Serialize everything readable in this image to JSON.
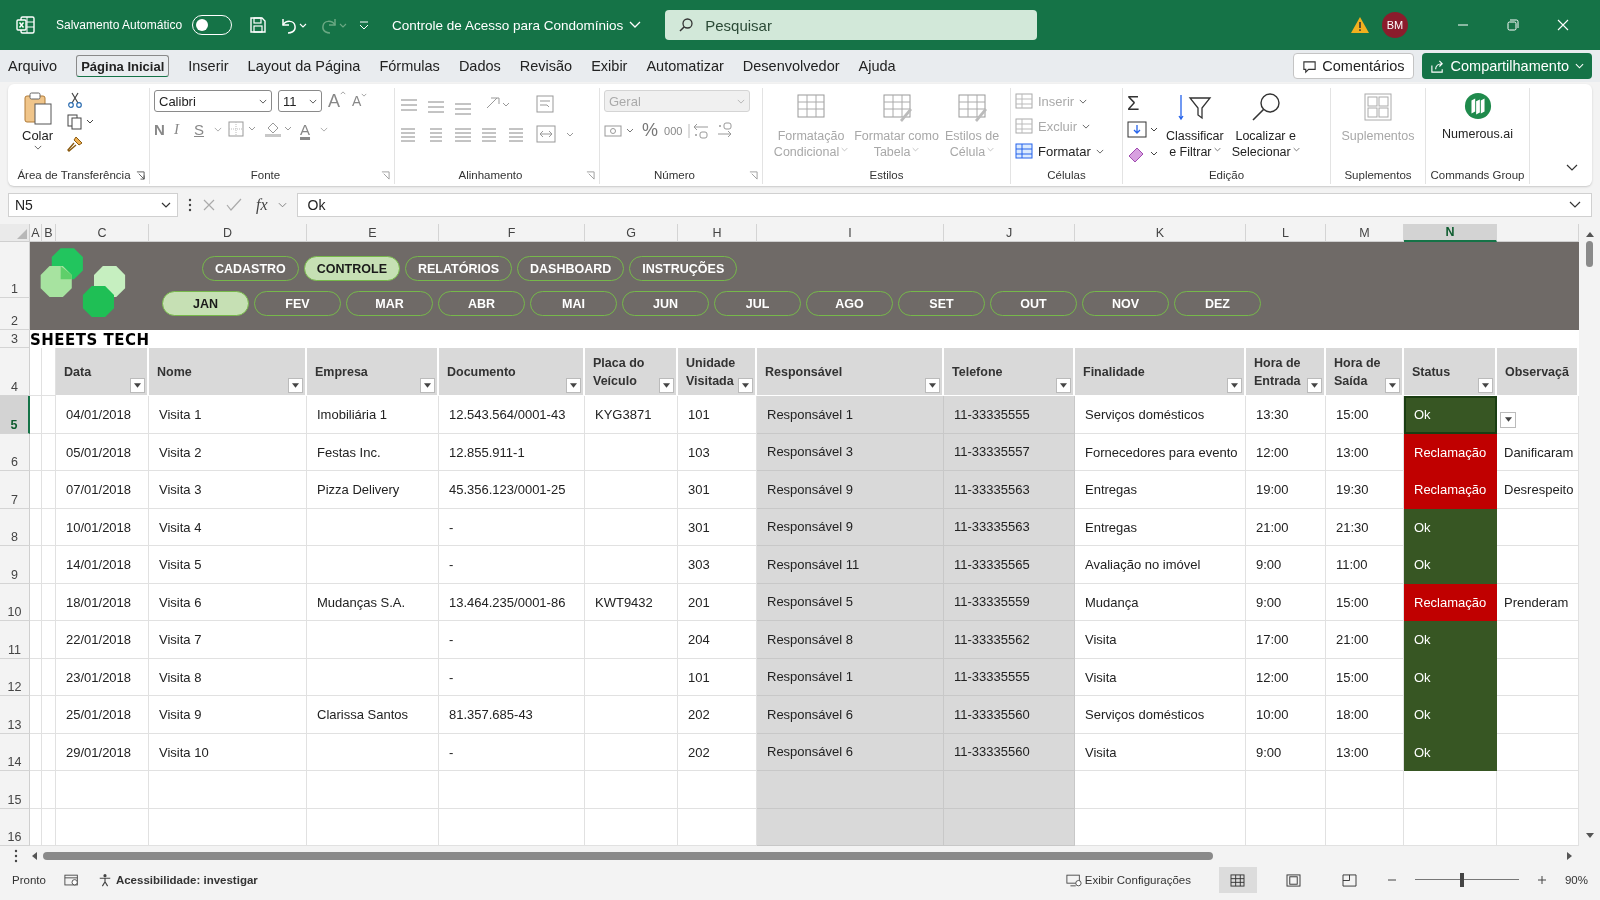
{
  "title_bar": {
    "autosave_label": "Salvamento Automático",
    "autosave_on": false,
    "document_title": "Controle de Acesso para Condomínios",
    "search_placeholder": "Pesquisar",
    "avatar_initials": "BM"
  },
  "menu_tabs": [
    {
      "label": "Arquivo",
      "selected": false
    },
    {
      "label": "Página Inicial",
      "selected": true
    },
    {
      "label": "Inserir",
      "selected": false
    },
    {
      "label": "Layout da Página",
      "selected": false
    },
    {
      "label": "Fórmulas",
      "selected": false
    },
    {
      "label": "Dados",
      "selected": false
    },
    {
      "label": "Revisão",
      "selected": false
    },
    {
      "label": "Exibir",
      "selected": false
    },
    {
      "label": "Automatizar",
      "selected": false
    },
    {
      "label": "Desenvolvedor",
      "selected": false
    },
    {
      "label": "Ajuda",
      "selected": false
    }
  ],
  "comments_button": "Comentários",
  "share_button": "Compartilhamento",
  "ribbon": {
    "clipboard": {
      "paste": "Colar",
      "caption": "Área de Transferência"
    },
    "font": {
      "family": "Calibri",
      "size": "11",
      "grow": "A",
      "shrink": "A",
      "bold": "N",
      "italic": "I",
      "underline": "S",
      "font_color": "A",
      "caption": "Fonte"
    },
    "alignment": {
      "caption": "Alinhamento"
    },
    "number": {
      "format": "Geral",
      "format_disabled": true,
      "percent": "%",
      "thousands": "000",
      "caption": "Número"
    },
    "styles": {
      "items": [
        {
          "lines": [
            "Formatação",
            "Condicional"
          ],
          "disabled": true
        },
        {
          "lines": [
            "Formatar como",
            "Tabela"
          ],
          "disabled": true
        },
        {
          "lines": [
            "Estilos de",
            "Célula"
          ],
          "disabled": true
        }
      ],
      "caption": "Estilos"
    },
    "cells": {
      "items": [
        {
          "label": "Inserir",
          "disabled": true
        },
        {
          "label": "Excluir",
          "disabled": true
        },
        {
          "label": "Formatar",
          "disabled": false
        }
      ],
      "caption": "Células"
    },
    "editing": {
      "autosum": "Σ",
      "items": [
        {
          "lines": [
            "Classificar",
            "e Filtrar"
          ]
        },
        {
          "lines": [
            "Localizar e",
            "Selecionar"
          ]
        }
      ],
      "caption": "Edição"
    },
    "addins": {
      "label": "Suplementos",
      "disabled": true,
      "caption": "Suplementos"
    },
    "commands": {
      "label": "Numerous.ai",
      "caption": "Commands Group"
    }
  },
  "formula_bar": {
    "name_box": "N5",
    "function_label": "fx",
    "value": "Ok"
  },
  "sheet": {
    "column_letters": [
      "A",
      "B",
      "C",
      "D",
      "E",
      "F",
      "G",
      "H",
      "I",
      "J",
      "K",
      "L",
      "M",
      "N"
    ],
    "row_numbers": [
      "1",
      "2",
      "3",
      "4",
      "5",
      "6",
      "7",
      "8",
      "9",
      "10",
      "11",
      "12",
      "13",
      "14",
      "15",
      "16"
    ],
    "nav_tabs": [
      {
        "label": "CADASTRO",
        "selected": false
      },
      {
        "label": "CONTROLE",
        "selected": true
      },
      {
        "label": "RELATÓRIOS",
        "selected": false
      },
      {
        "label": "DASHBOARD",
        "selected": false
      },
      {
        "label": "INSTRUÇÕES",
        "selected": false
      }
    ],
    "months": [
      {
        "label": "JAN",
        "selected": true
      },
      {
        "label": "FEV",
        "selected": false
      },
      {
        "label": "MAR",
        "selected": false
      },
      {
        "label": "ABR",
        "selected": false
      },
      {
        "label": "MAI",
        "selected": false
      },
      {
        "label": "JUN",
        "selected": false
      },
      {
        "label": "JUL",
        "selected": false
      },
      {
        "label": "AGO",
        "selected": false
      },
      {
        "label": "SET",
        "selected": false
      },
      {
        "label": "OUT",
        "selected": false
      },
      {
        "label": "NOV",
        "selected": false
      },
      {
        "label": "DEZ",
        "selected": false
      }
    ],
    "brand": "SHEETS TECH",
    "columns": [
      "Data",
      "Nome",
      "Empresa",
      "Documento",
      "Placa do Veículo",
      "Unidade Visitada",
      "Responsável",
      "Telefone",
      "Finalidade",
      "Hora de Entrada",
      "Hora de Saída",
      "Status",
      "Observaçã"
    ],
    "rows": [
      {
        "date": "04/01/2018",
        "name": "Visita 1",
        "company": "Imobiliária 1",
        "document": "12.543.564/0001-43",
        "plate": "KYG3871",
        "unit": "101",
        "responsible": "Responsável 1",
        "phone": "11-33335555",
        "purpose": "Serviços domésticos",
        "entry": "13:30",
        "exit": "15:00",
        "status": {
          "label": "Ok",
          "kind": "ok",
          "selected": true
        }
      },
      {
        "date": "05/01/2018",
        "name": "Visita 2",
        "company": "Festas Inc.",
        "document": "12.855.911-1",
        "unit": "103",
        "responsible": "Responsável 3",
        "phone": "11-33335557",
        "purpose": "Fornecedores para evento",
        "entry": "12:00",
        "exit": "13:00",
        "status": {
          "label": "Reclamação",
          "kind": "complaint",
          "selected": false
        },
        "note": "Danificaram"
      },
      {
        "date": "07/01/2018",
        "name": "Visita 3",
        "company": "Pizza Delivery",
        "document": "45.356.123/0001-25",
        "unit": "301",
        "responsible": "Responsável 9",
        "phone": "11-33335563",
        "purpose": "Entregas",
        "entry": "19:00",
        "exit": "19:30",
        "status": {
          "label": "Reclamação",
          "kind": "complaint",
          "selected": false
        },
        "note": "Desrespeito"
      },
      {
        "date": "10/01/2018",
        "name": "Visita 4",
        "document": "-",
        "unit": "301",
        "responsible": "Responsável 9",
        "phone": "11-33335563",
        "purpose": "Entregas",
        "entry": "21:00",
        "exit": "21:30",
        "status": {
          "label": "Ok",
          "kind": "ok",
          "selected": false
        }
      },
      {
        "date": "14/01/2018",
        "name": "Visita 5",
        "document": "-",
        "unit": "303",
        "responsible": "Responsável 11",
        "phone": "11-33335565",
        "purpose": "Avaliação no imóvel",
        "entry": "9:00",
        "exit": "11:00",
        "status": {
          "label": "Ok",
          "kind": "ok",
          "selected": false
        }
      },
      {
        "date": "18/01/2018",
        "name": "Visita 6",
        "company": "Mudanças S.A.",
        "document": "13.464.235/0001-86",
        "plate": "KWT9432",
        "unit": "201",
        "responsible": "Responsável 5",
        "phone": "11-33335559",
        "purpose": "Mudança",
        "entry": "9:00",
        "exit": "15:00",
        "status": {
          "label": "Reclamação",
          "kind": "complaint",
          "selected": false
        },
        "note": "Prenderam"
      },
      {
        "date": "22/01/2018",
        "name": "Visita 7",
        "document": "-",
        "unit": "204",
        "responsible": "Responsável 8",
        "phone": "11-33335562",
        "purpose": "Visita",
        "entry": "17:00",
        "exit": "21:00",
        "status": {
          "label": "Ok",
          "kind": "ok",
          "selected": false
        }
      },
      {
        "date": "23/01/2018",
        "name": "Visita 8",
        "document": "-",
        "unit": "101",
        "responsible": "Responsável 1",
        "phone": "11-33335555",
        "purpose": "Visita",
        "entry": "12:00",
        "exit": "15:00",
        "status": {
          "label": "Ok",
          "kind": "ok",
          "selected": false
        }
      },
      {
        "date": "25/01/2018",
        "name": "Visita 9",
        "company": "Clarissa Santos",
        "document": "81.357.685-43",
        "unit": "202",
        "responsible": "Responsável 6",
        "phone": "11-33335560",
        "purpose": "Serviços domésticos",
        "entry": "10:00",
        "exit": "18:00",
        "status": {
          "label": "Ok",
          "kind": "ok",
          "selected": false
        }
      },
      {
        "date": "29/01/2018",
        "name": "Visita 10",
        "document": "-",
        "unit": "202",
        "responsible": "Responsável 6",
        "phone": "11-33335560",
        "purpose": "Visita",
        "entry": "9:00",
        "exit": "13:00",
        "status": {
          "label": "Ok",
          "kind": "ok",
          "selected": false
        }
      }
    ]
  },
  "status_bar": {
    "ready": "Pronto",
    "accessibility": "Acessibilidade: investigar",
    "display_settings": "Exibir Configurações",
    "zoom": {
      "level": 0.45,
      "reading": "90%"
    }
  }
}
